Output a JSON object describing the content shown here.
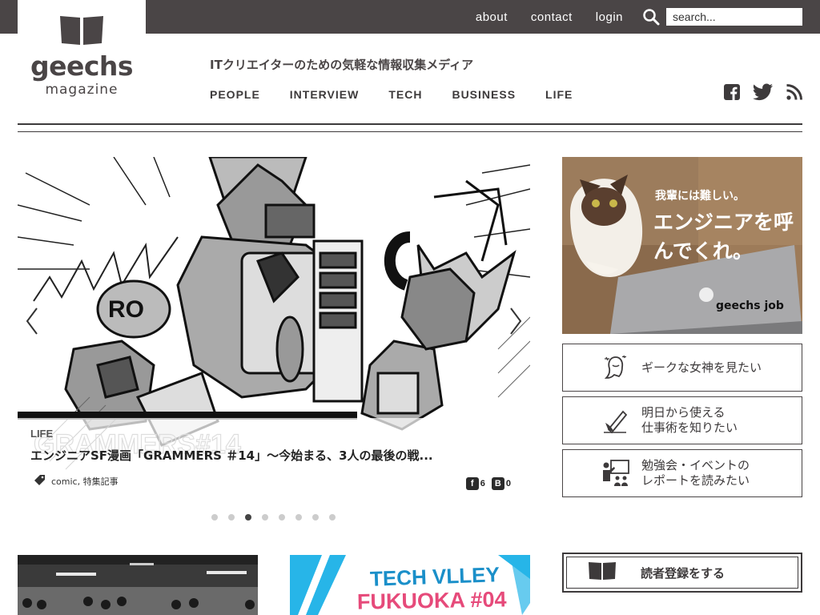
{
  "topnav": {
    "about": "about",
    "contact": "contact",
    "login": "login",
    "search_placeholder": "search..."
  },
  "logo": {
    "word": "geechs",
    "sub": "magazine"
  },
  "tagline": "ITクリエイターのための気軽な情報収集メディア",
  "categories": [
    "PEOPLE",
    "INTERVIEW",
    "TECH",
    "BUSINESS",
    "LIFE"
  ],
  "social_icons": [
    "facebook-icon",
    "twitter-icon",
    "rss-icon"
  ],
  "hero": {
    "label": "LIFE",
    "title": "エンジニアSF漫画「GRAMMERS ＃14」〜今始まる、3人の最後の戦...",
    "tags": "comic, 特集記事",
    "fb_count": "6",
    "hatena_count": "0",
    "slides": 8,
    "active_slide": 3
  },
  "ad": {
    "line1": "我輩には難しい。",
    "line2": "エンジニアを呼んでくれ。",
    "brand": "geechs job"
  },
  "side_buttons": [
    {
      "text": "ギークな女神を見たい",
      "icon": "goddess-icon"
    },
    {
      "text_lines": [
        "明日から使える",
        "仕事術を知りたい"
      ],
      "icon": "pen-icon"
    },
    {
      "text_lines": [
        "勉強会・イベントの",
        "レポートを読みたい"
      ],
      "icon": "presentation-icon"
    }
  ],
  "subscribe": {
    "text": "読者登録をする"
  },
  "thumb2": {
    "line1": "TECH VLLEY",
    "line2": "FUKUOKA #04"
  },
  "colors": {
    "topbar": "#4a4546",
    "text": "#3d3a3b",
    "accent_blue": "#1a8fc9",
    "accent_pink": "#e64a7a"
  }
}
